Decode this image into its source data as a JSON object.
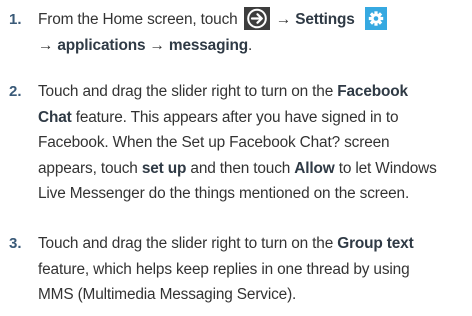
{
  "steps": [
    {
      "number": "1.",
      "line1_pre": "From the Home screen, touch",
      "arrow1": "→",
      "settings": "Settings",
      "arrow2": "→",
      "applications": "applications",
      "arrow3": "→",
      "messaging": "messaging",
      "end": "."
    },
    {
      "number": "2.",
      "l1_pre": "Touch and drag the slider right to turn on the ",
      "facebook": "Facebook",
      "chat": "Chat",
      "l2_rest": " feature. This appears after you have signed in to",
      "l3": "Facebook. When the Set up Facebook Chat? screen",
      "l4_pre": "appears, touch ",
      "set_up": "set up",
      "l4_mid": " and then touch ",
      "allow": "Allow",
      "l4_post": " to let Windows",
      "l5": "Live Messenger do the things mentioned on the screen."
    },
    {
      "number": "3.",
      "l1_pre": "Touch and drag the slider right to turn on the ",
      "group_text": "Group text",
      "l2": "feature, which helps keep replies in one thread by using",
      "l3": "MMS (Multimedia Messaging Service)."
    }
  ],
  "icons": {
    "apps_icon": "arrow-circle-icon",
    "settings_icon": "gear-icon",
    "accent_color": "#3a5a78",
    "settings_icon_bg": "#36a9e1"
  }
}
